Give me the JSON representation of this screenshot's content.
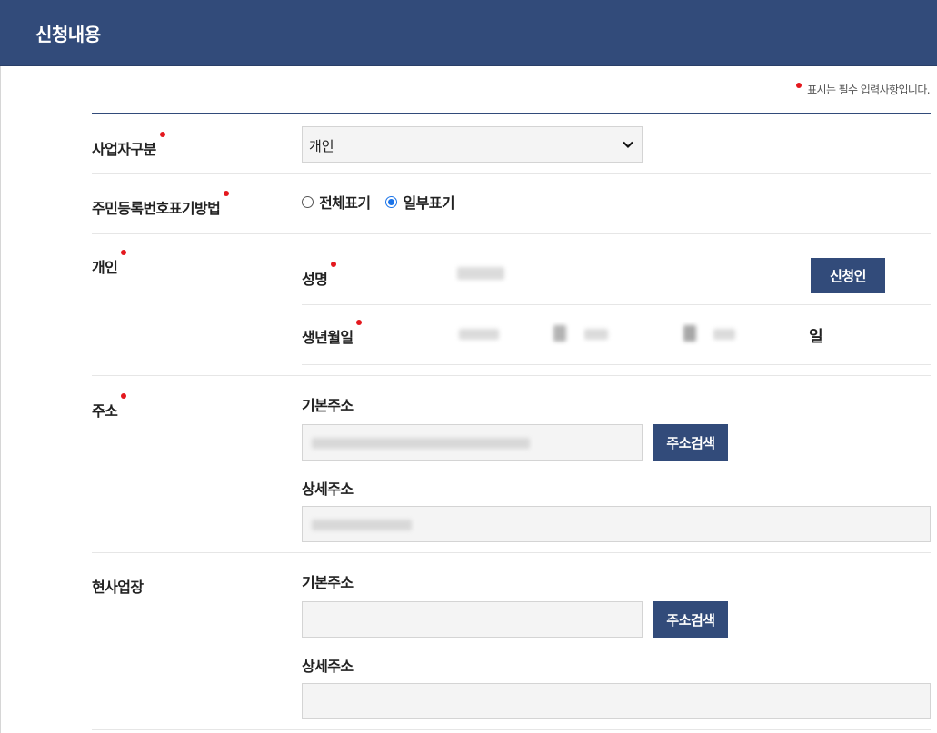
{
  "header": {
    "title": "신청내용"
  },
  "required_note": "표시는 필수 입력사항입니다.",
  "business_type": {
    "label": "사업자구분",
    "selected": "개인"
  },
  "id_display": {
    "label": "주민등록번호표기방법",
    "options": [
      "전체표기",
      "일부표기"
    ],
    "selected": "일부표기"
  },
  "individual": {
    "label": "개인",
    "name_label": "성명",
    "applicant_button": "신청인",
    "birth_label": "생년월일",
    "day_suffix": "일"
  },
  "address": {
    "label": "주소",
    "basic_label": "기본주소",
    "search_button": "주소검색",
    "detail_label": "상세주소"
  },
  "workplace": {
    "label": "현사업장",
    "basic_label": "기본주소",
    "search_button": "주소검색",
    "detail_label": "상세주소"
  },
  "colors": {
    "header": "#324b7a",
    "required": "#e4181e",
    "button": "#324b7a"
  }
}
